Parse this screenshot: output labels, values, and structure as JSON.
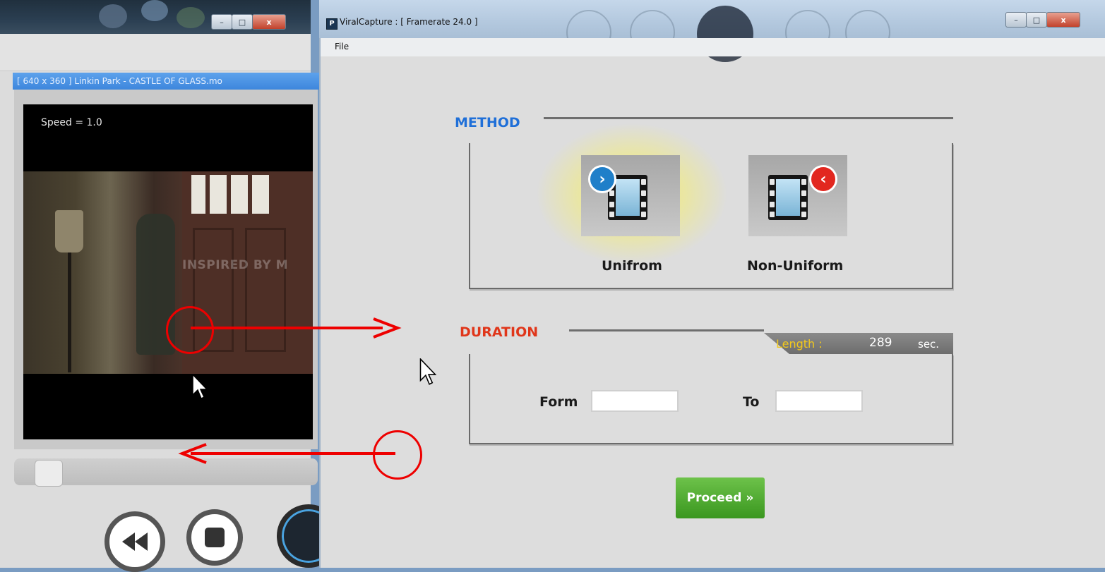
{
  "player": {
    "video_tab": "[ 640 x 360 ] Linkin Park - CASTLE OF GLASS.mo",
    "speed_text": "Speed = 1.0",
    "watermark": "INSPIRED BY M",
    "seek_position": 0.07,
    "window_buttons": {
      "minimize": "–",
      "maximize": "□",
      "close": "x"
    }
  },
  "main": {
    "title": "ViralCapture : [ Framerate 24.0 ]",
    "app_icon_letter": "P",
    "menu": {
      "file": "File"
    },
    "window_buttons": {
      "minimize": "–",
      "maximize": "□",
      "close": "x"
    },
    "method": {
      "title": "METHOD",
      "options": [
        {
          "label": "Unifrom",
          "selected": true,
          "icon": "film-forward-icon"
        },
        {
          "label": "Non-Uniform",
          "selected": false,
          "icon": "film-backward-icon"
        }
      ]
    },
    "duration": {
      "title": "DURATION",
      "length_label": "Length :",
      "length_value": "289",
      "length_unit": "sec.",
      "from_label": "Form",
      "from_value": "",
      "to_label": "To",
      "to_value": ""
    },
    "proceed_label": "Proceed »"
  },
  "colors": {
    "method_title": "#1f6fd8",
    "duration_title": "#e0361a",
    "length_label": "#f2c81c",
    "proceed": "#4aab2a",
    "annotation": "#e00000",
    "highlight_glow": "#f6ef6a"
  }
}
